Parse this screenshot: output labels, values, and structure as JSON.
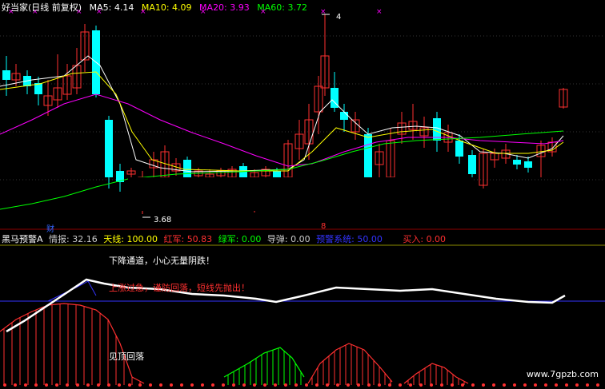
{
  "main": {
    "title": "好当家(日线 前复权)",
    "ma": [
      {
        "label": "MA5:",
        "value": "4.14",
        "color": "#ffffff"
      },
      {
        "label": "MA10:",
        "value": "4.09",
        "color": "#ffff00"
      },
      {
        "label": "MA20:",
        "value": "3.93",
        "color": "#ff00ff"
      },
      {
        "label": "MA60:",
        "value": "3.72",
        "color": "#00ff00"
      }
    ],
    "high_marker": "4",
    "low_marker": "3.68",
    "event_marker_1": "财",
    "event_marker_2": "8"
  },
  "indicator": {
    "name": "黑马预警A",
    "fields": [
      {
        "label": "情报:",
        "value": "32.16",
        "color": "#cccccc"
      },
      {
        "label": "天线:",
        "value": "100.00",
        "color": "#ffff00"
      },
      {
        "label": "红军:",
        "value": "50.83",
        "color": "#ff3030"
      },
      {
        "label": "绿军:",
        "value": "0.00",
        "color": "#00ff00"
      },
      {
        "label": "导弹:",
        "value": "0.00",
        "color": "#cccccc"
      },
      {
        "label": "预警系统:",
        "value": "50.00",
        "color": "#3333ff"
      },
      {
        "label": "买入:",
        "value": "0.00",
        "color": "#ff3030"
      }
    ],
    "msg_down": "下降通道，小心无量阴跌！",
    "msg_top": "上涨过急，谨防回落，短线先抛出！",
    "msg_fall": "见顶回落"
  },
  "watermark": "www.7gpzb.com",
  "chart_data": {
    "type": "candlestick",
    "ma_latest": {
      "MA5": 4.14,
      "MA10": 4.09,
      "MA20": 3.93,
      "MA60": 3.72
    },
    "marked_high": 4,
    "marked_low": 3.68,
    "indicator_latest": {
      "情报": 32.16,
      "天线": 100.0,
      "红军": 50.83,
      "绿军": 0.0,
      "导弹": 0.0,
      "预警系统": 50.0,
      "买入": 0.0
    }
  }
}
